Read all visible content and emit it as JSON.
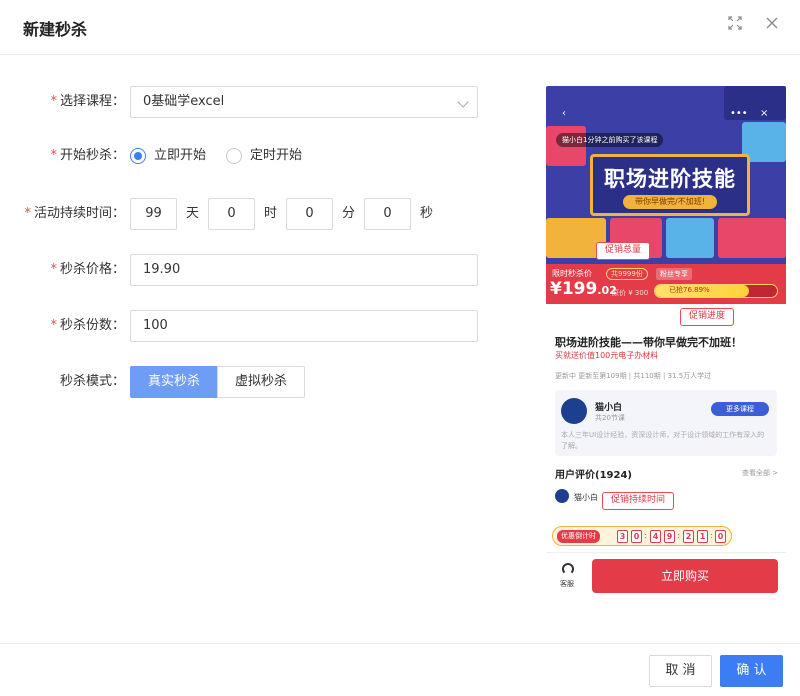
{
  "dialog": {
    "title": "新建秒杀"
  },
  "form": {
    "course": {
      "label": "选择课程：",
      "value": "0基础学excel"
    },
    "start": {
      "label": "开始秒杀：",
      "options": [
        "立即开始",
        "定时开始"
      ],
      "selected": "立即开始"
    },
    "duration": {
      "label": "活动持续时间：",
      "days": "99",
      "days_unit": "天",
      "hours": "0",
      "hours_unit": "时",
      "minutes": "0",
      "minutes_unit": "分",
      "seconds": "0",
      "seconds_unit": "秒"
    },
    "price": {
      "label": "秒杀价格：",
      "value": "19.90"
    },
    "quantity": {
      "label": "秒杀份数：",
      "value": "100"
    },
    "mode": {
      "label": "秒杀模式：",
      "options": [
        "真实秒杀",
        "虚拟秒杀"
      ],
      "selected": "真实秒杀"
    }
  },
  "preview": {
    "banner_message": "猫小白1分钟之前购买了该课程",
    "banner_title": "职场进阶技能",
    "banner_subtitle": "带你早做完/不加班!",
    "price_label": "限时秒杀价",
    "total_tag": "共9999份",
    "tag2": "粉丝专享",
    "price_main": "¥199",
    "price_decimal": ".02",
    "orig_price": "原价 ¥ 300",
    "progress_text": "已抢76.89%",
    "progress_fraction": 0.7689,
    "course_title": "职场进阶技能——带你早做完不加班！",
    "course_sub": "买就送价值100元电子办材料",
    "course_meta": "更新中   更新至第109期 | 共110期 | 31.5万人学过",
    "teacher_name": "猫小白",
    "teacher_count": "共20节课",
    "more_courses": "更多课程",
    "teacher_desc": "本人三年UI设计经验，资深设计师，对于设计领域的工作有深入的了解。",
    "reviews_title": "用户评价(1924)",
    "reviews_all": "查看全部 >",
    "reviewer": "猫小白",
    "countdown_label": "优惠倒计时",
    "countdown_digits": [
      "3",
      "0",
      "4",
      "9",
      "2",
      "1",
      "0",
      "4"
    ],
    "service": "客服",
    "buy_now": "立即购买",
    "callouts": {
      "total": "促销总量",
      "progress": "促销进度",
      "duration": "促销持续时间"
    }
  },
  "footer": {
    "cancel": "取 消",
    "confirm": "确 认"
  }
}
